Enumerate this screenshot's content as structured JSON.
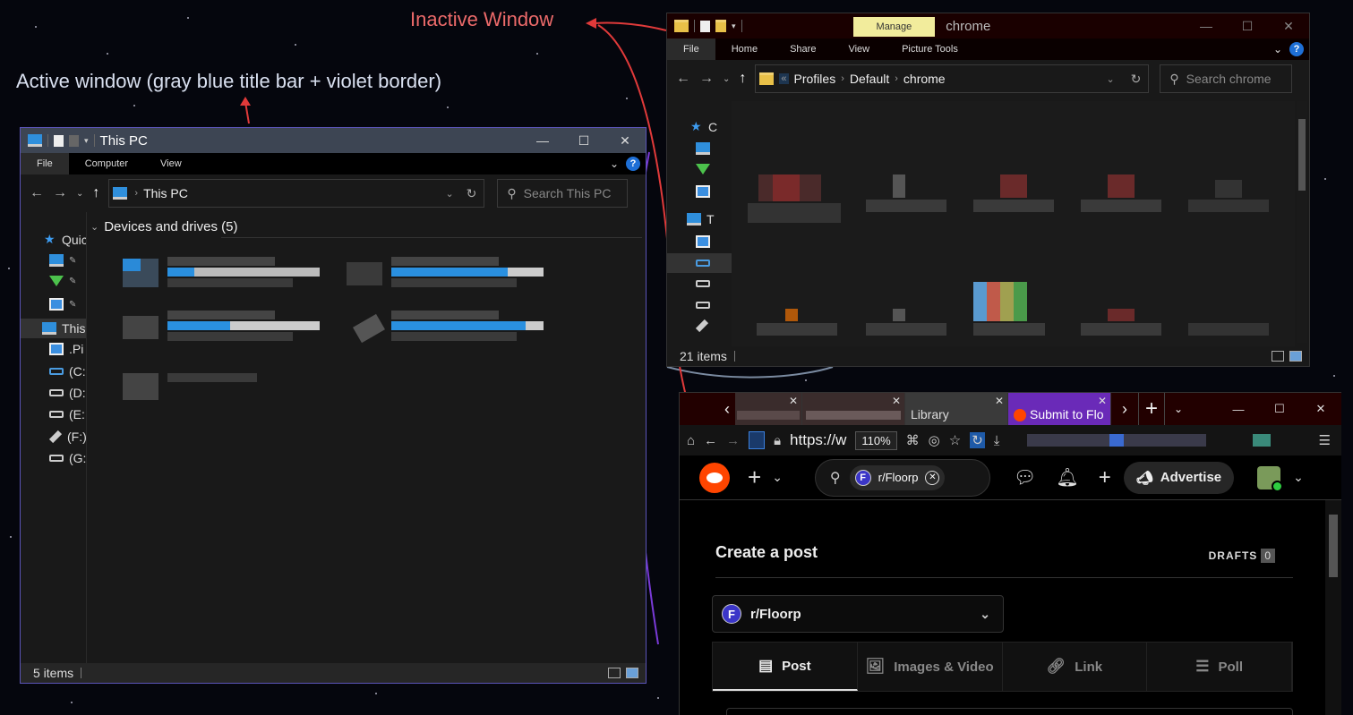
{
  "annotations": {
    "active": "Active window (gray blue title bar + violet border)",
    "inactive": "Inactive Window"
  },
  "colors": {
    "active_titlebar": "#3d4553",
    "active_border": "#5b54b8",
    "inactive_titlebar": "#1a0000",
    "annotation_red": "#ec6a6a"
  },
  "active_explorer": {
    "title": "This PC",
    "controls": {
      "minimize": "—",
      "maximize": "☐",
      "close": "✕"
    },
    "ribbon_tabs": [
      "File",
      "Computer",
      "View"
    ],
    "address_crumb": "This PC",
    "search_placeholder": "Search This PC",
    "nav": {
      "quick": "Quic",
      "thispc": "This",
      "items": [
        ".Pi",
        "(C:",
        "(D:",
        "(E:",
        "(F:)",
        "(G:"
      ]
    },
    "group_header": "Devices and drives (5)",
    "status": "5 items"
  },
  "inactive_explorer": {
    "title": "chrome",
    "manage_tab": "Manage",
    "controls": {
      "minimize": "—",
      "maximize": "☐",
      "close": "✕"
    },
    "ribbon_tabs": [
      "File",
      "Home",
      "Share",
      "View",
      "Picture Tools"
    ],
    "crumbs": [
      "Profiles",
      "Default",
      "chrome"
    ],
    "search_placeholder": "Search chrome",
    "nav": {
      "c": "C",
      "t": "T"
    },
    "status": "21 items"
  },
  "browser": {
    "tabs": {
      "library": "Library",
      "submit": "Submit to Flo"
    },
    "url": "https://w",
    "zoom": "110%",
    "controls": {
      "minimize": "—",
      "maximize": "☐",
      "close": "✕"
    },
    "reddit": {
      "search_chip": "r/Floorp",
      "advertise": "Advertise",
      "create_title": "Create a post",
      "drafts_label": "DRAFTS",
      "drafts_count": "0",
      "subreddit": "r/Floorp",
      "post_tabs": [
        "Post",
        "Images & Video",
        "Link",
        "Poll"
      ]
    }
  }
}
